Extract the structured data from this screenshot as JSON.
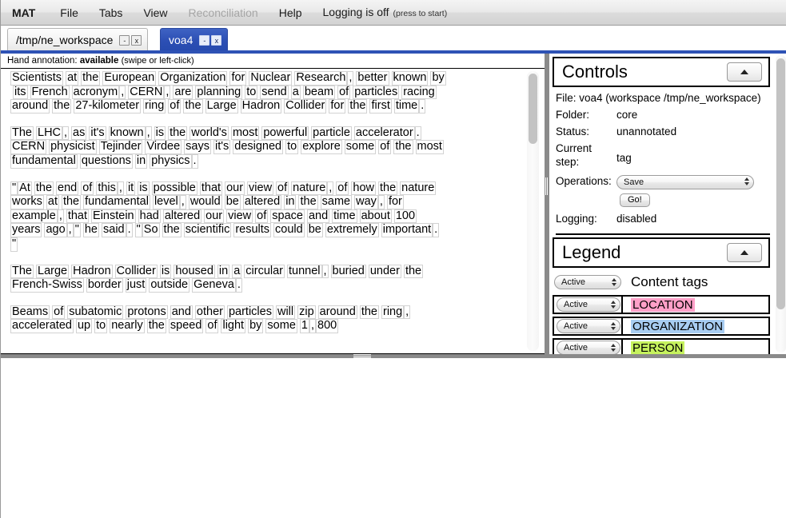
{
  "menubar": {
    "brand": "MAT",
    "items": [
      {
        "label": "File",
        "disabled": false
      },
      {
        "label": "Tabs",
        "disabled": false
      },
      {
        "label": "View",
        "disabled": false
      },
      {
        "label": "Reconciliation",
        "disabled": true
      },
      {
        "label": "Help",
        "disabled": false
      }
    ],
    "logging_status": "Logging is off",
    "logging_hint": "(press to start)"
  },
  "tabs": [
    {
      "label": "/tmp/ne_workspace",
      "active": false,
      "minimize": "-",
      "close": "x"
    },
    {
      "label": "voa4",
      "active": true,
      "minimize": "-",
      "close": "x"
    }
  ],
  "document": {
    "hand_annotation_prefix": "Hand annotation:",
    "hand_annotation_state": "available",
    "hand_annotation_hint": "(swipe or left-click)",
    "paragraphs": [
      "Scientists at the European Organization for Nuclear Research, better known by its French acronym, CERN, are planning to send a beam of particles racing around the 27-kilometer ring of the Large Hadron Collider for the first time.",
      "The LHC, as it's known, is the world's most powerful particle accelerator. CERN physicist Tejinder Virdee says it's designed to explore some of the most fundamental questions in physics.",
      "\"At the end of this, it is possible that our view of nature, of how the nature works at the fundamental level, would be altered in the same way, for example, that Einstein had altered our view of space and time about 100 years ago,\" he said. \"So the scientific results could be extremely important.\"",
      "The Large Hadron Collider is housed in a circular tunnel, buried under the French-Swiss border just outside Geneva.",
      "Beams of subatomic protons and other particles will zip around the ring, accelerated up to nearly the speed of light by some 1,800"
    ]
  },
  "controls": {
    "title": "Controls",
    "collapse_icon": "chevron-up-icon",
    "file_line": "File: voa4 (workspace /tmp/ne_workspace)",
    "folder_label": "Folder:",
    "folder_value": "core",
    "status_label": "Status:",
    "status_value": "unannotated",
    "current_step_label": "Current step:",
    "current_step_value": "tag",
    "operations_label": "Operations:",
    "operations_value": "Save",
    "operations_options": [
      "Save"
    ],
    "go_label": "Go!",
    "logging_label": "Logging:",
    "logging_value": "disabled"
  },
  "legend": {
    "title": "Legend",
    "collapse_icon": "chevron-up-icon",
    "global_state": "Active",
    "state_options": [
      "Active"
    ],
    "content_tags_heading": "Content tags",
    "tags": [
      {
        "name": "LOCATION",
        "state": "Active",
        "color": "#FFA0C8"
      },
      {
        "name": "ORGANIZATION",
        "state": "Active",
        "color": "#A8CDF2"
      },
      {
        "name": "PERSON",
        "state": "Active",
        "color": "#C6F25E"
      }
    ]
  }
}
